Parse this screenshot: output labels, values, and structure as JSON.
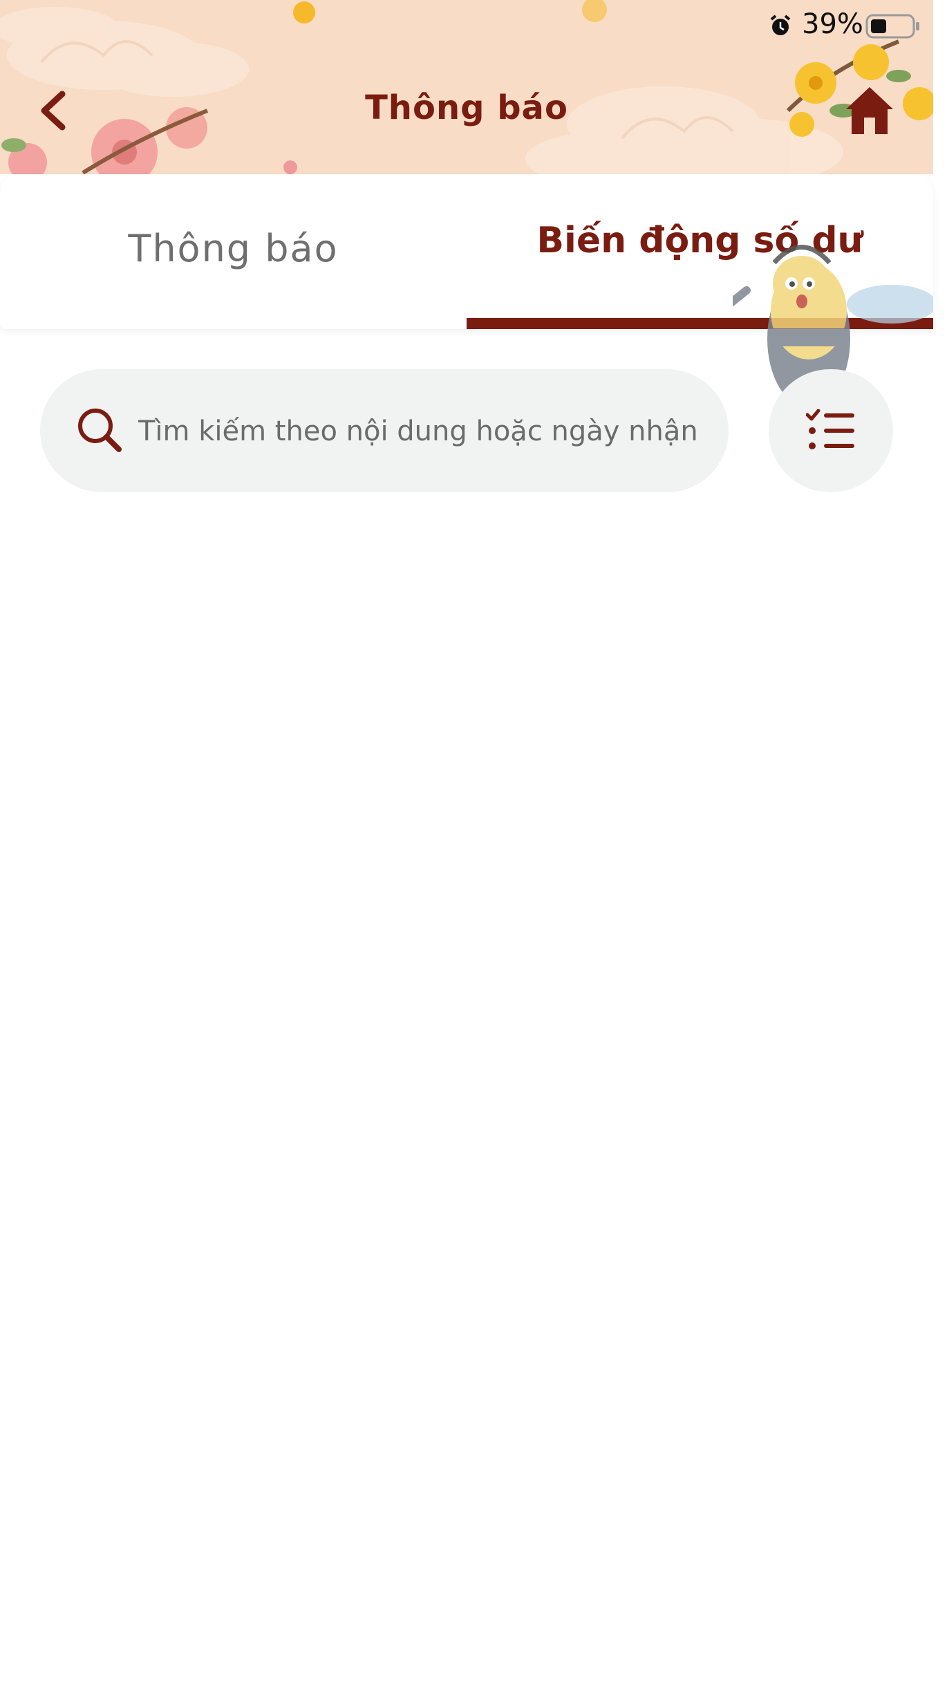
{
  "status_bar": {
    "alarm_icon": "alarm-icon",
    "battery_percent": "39%",
    "battery_icon": "battery-icon"
  },
  "header": {
    "title": "Thông báo",
    "back_icon": "chevron-left-icon",
    "home_icon": "home-icon",
    "title_color": "#7a1c10",
    "background_color": "#f8dcc5"
  },
  "tabs": [
    {
      "label": "Thông báo",
      "active": false
    },
    {
      "label": "Biến động số dư",
      "active": true
    }
  ],
  "search": {
    "placeholder": "Tìm kiếm theo nội dung hoặc ngày nhận",
    "value": "",
    "icon": "search-icon"
  },
  "filter": {
    "icon": "checklist-icon"
  },
  "colors": {
    "accent": "#7a1c10",
    "search_bg": "#f1f2f2",
    "inactive_tab_text": "#6f6f6f"
  }
}
